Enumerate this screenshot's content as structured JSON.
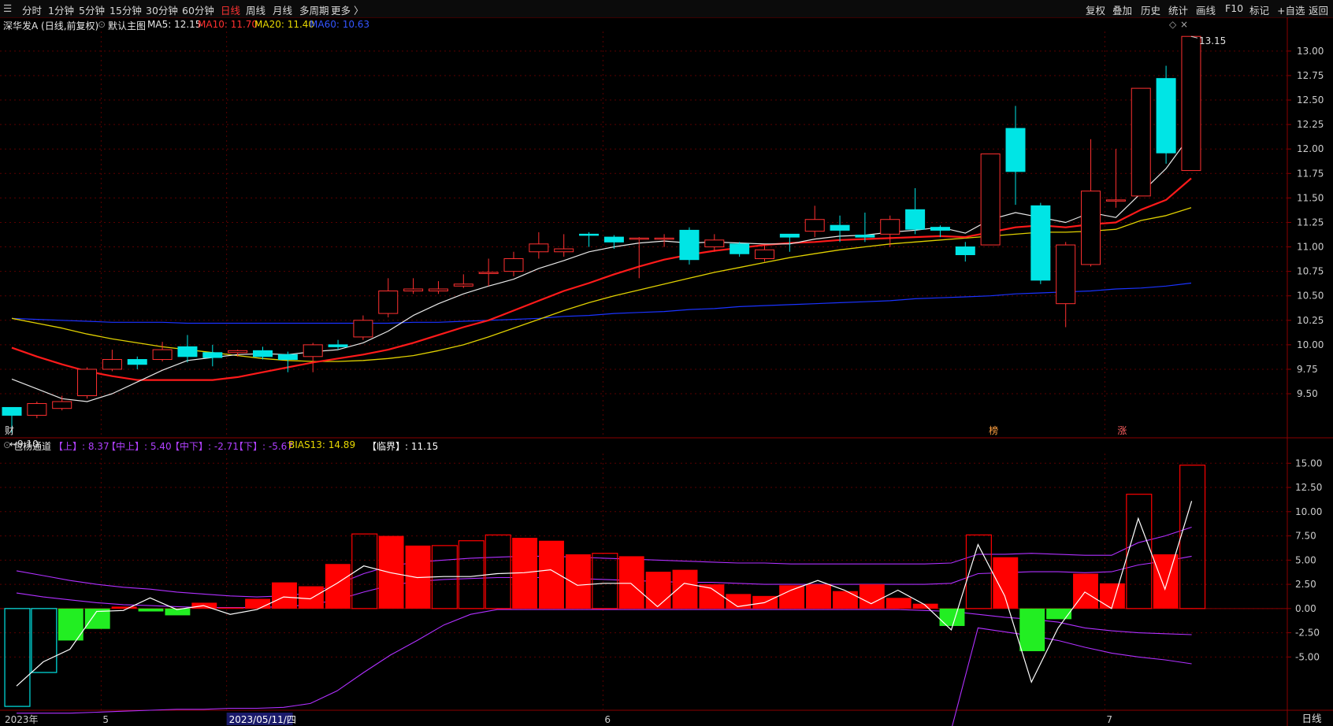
{
  "toolbar": {
    "periods": [
      {
        "label": "分时",
        "active": false
      },
      {
        "label": "1分钟",
        "active": false
      },
      {
        "label": "5分钟",
        "active": false
      },
      {
        "label": "15分钟",
        "active": false
      },
      {
        "label": "30分钟",
        "active": false
      },
      {
        "label": "60分钟",
        "active": false
      },
      {
        "label": "日线",
        "active": true
      },
      {
        "label": "周线",
        "active": false
      },
      {
        "label": "月线",
        "active": false
      },
      {
        "label": "多周期",
        "active": false
      },
      {
        "label": "更多 〉",
        "active": false
      }
    ],
    "right": [
      "复权",
      "叠加",
      "历史",
      "统计",
      "画线",
      "F10",
      "标记",
      "+自选",
      "返回"
    ]
  },
  "main_header": {
    "stock": "深华发A (日线,前复权)",
    "indicator": "默认主图",
    "ma5": "MA5: 12.15",
    "ma10": "MA10: 11.70",
    "ma20": "MA20: 11.40",
    "ma60": "MA60: 10.63"
  },
  "osc_header": {
    "name": "包杨通道",
    "up": "【上】: 8.37",
    "mid_up": "【中上】: 5.40",
    "mid_down": "【中下】: -2.71",
    "down": "【下】: -5.67",
    "bias": "BIAS13: 14.89",
    "critical": "【临界】: 11.15"
  },
  "annotations": {
    "high_label": "13.15",
    "low_label": "←9.10",
    "cai_marker": "财",
    "bang_marker": "榜",
    "zhang_marker": "涨"
  },
  "x_axis": {
    "labels": [
      {
        "text": "2023年",
        "idx": 0
      },
      {
        "text": "5",
        "idx": 4
      },
      {
        "text": "2023/05/11/四",
        "idx": 9
      },
      {
        "text": "6",
        "idx": 24
      },
      {
        "text": "7",
        "idx": 44
      }
    ]
  },
  "bottom_tab": "日线",
  "colors": {
    "up": "#ff3030",
    "down": "#00e5e5",
    "ma5": "#e8e8e8",
    "ma10": "#ff1a1a",
    "ma20": "#e0d000",
    "ma60": "#1a33ff",
    "channel": "#b030ff",
    "bias": "#ffffff",
    "osc_up": "#ff0000",
    "osc_down": "#22ee22",
    "grid": "#5a0000",
    "axis_text": "#cccccc"
  },
  "chart_data": [
    {
      "type": "candlestick",
      "title": "深华发A (日线,前复权)",
      "y_ticks": [
        9.5,
        9.75,
        10.0,
        10.25,
        10.5,
        10.75,
        11.0,
        11.25,
        11.5,
        11.75,
        12.0,
        12.25,
        12.5,
        12.75,
        13.0
      ],
      "ylim": [
        9.05,
        13.2
      ],
      "candles": [
        {
          "o": 9.36,
          "c": 9.28,
          "h": 9.36,
          "l": 9.1
        },
        {
          "o": 9.28,
          "c": 9.4,
          "h": 9.42,
          "l": 9.25
        },
        {
          "o": 9.35,
          "c": 9.42,
          "h": 9.48,
          "l": 9.33
        },
        {
          "o": 9.48,
          "c": 9.75,
          "h": 9.77,
          "l": 9.45
        },
        {
          "o": 9.75,
          "c": 9.85,
          "h": 9.95,
          "l": 9.73
        },
        {
          "o": 9.85,
          "c": 9.8,
          "h": 9.88,
          "l": 9.75
        },
        {
          "o": 9.85,
          "c": 9.95,
          "h": 10.03,
          "l": 9.83
        },
        {
          "o": 9.98,
          "c": 9.88,
          "h": 10.1,
          "l": 9.82
        },
        {
          "o": 9.92,
          "c": 9.87,
          "h": 10.0,
          "l": 9.78
        },
        {
          "o": 9.92,
          "c": 9.94,
          "h": 9.95,
          "l": 9.88
        },
        {
          "o": 9.94,
          "c": 9.88,
          "h": 9.98,
          "l": 9.85
        },
        {
          "o": 9.9,
          "c": 9.85,
          "h": 9.93,
          "l": 9.72
        },
        {
          "o": 9.88,
          "c": 10.0,
          "h": 10.02,
          "l": 9.72
        },
        {
          "o": 10.0,
          "c": 9.98,
          "h": 10.05,
          "l": 9.95
        },
        {
          "o": 10.08,
          "c": 10.25,
          "h": 10.3,
          "l": 10.05
        },
        {
          "o": 10.32,
          "c": 10.55,
          "h": 10.68,
          "l": 10.28
        },
        {
          "o": 10.55,
          "c": 10.57,
          "h": 10.68,
          "l": 10.52
        },
        {
          "o": 10.55,
          "c": 10.57,
          "h": 10.65,
          "l": 10.52
        },
        {
          "o": 10.6,
          "c": 10.62,
          "h": 10.72,
          "l": 10.58
        },
        {
          "o": 10.74,
          "c": 10.74,
          "h": 10.88,
          "l": 10.6
        },
        {
          "o": 10.75,
          "c": 10.88,
          "h": 10.95,
          "l": 10.7
        },
        {
          "o": 10.95,
          "c": 11.03,
          "h": 11.15,
          "l": 10.88
        },
        {
          "o": 10.95,
          "c": 10.98,
          "h": 11.13,
          "l": 10.9
        },
        {
          "o": 11.13,
          "c": 11.12,
          "h": 11.15,
          "l": 11.0
        },
        {
          "o": 11.1,
          "c": 11.05,
          "h": 11.12,
          "l": 10.98
        },
        {
          "o": 11.08,
          "c": 11.09,
          "h": 11.1,
          "l": 10.68
        },
        {
          "o": 11.08,
          "c": 11.09,
          "h": 11.13,
          "l": 11.0
        },
        {
          "o": 11.17,
          "c": 10.87,
          "h": 11.2,
          "l": 10.82
        },
        {
          "o": 11.0,
          "c": 11.07,
          "h": 11.13,
          "l": 10.95
        },
        {
          "o": 11.03,
          "c": 10.93,
          "h": 11.05,
          "l": 10.9
        },
        {
          "o": 10.88,
          "c": 10.97,
          "h": 11.02,
          "l": 10.85
        },
        {
          "o": 11.13,
          "c": 11.1,
          "h": 11.12,
          "l": 10.95
        },
        {
          "o": 11.16,
          "c": 11.28,
          "h": 11.42,
          "l": 11.1
        },
        {
          "o": 11.22,
          "c": 11.17,
          "h": 11.32,
          "l": 11.05
        },
        {
          "o": 11.12,
          "c": 11.1,
          "h": 11.35,
          "l": 11.05
        },
        {
          "o": 11.13,
          "c": 11.28,
          "h": 11.32,
          "l": 11.0
        },
        {
          "o": 11.38,
          "c": 11.18,
          "h": 11.6,
          "l": 11.13
        },
        {
          "o": 11.2,
          "c": 11.17,
          "h": 11.22,
          "l": 11.1
        },
        {
          "o": 11.0,
          "c": 10.92,
          "h": 11.05,
          "l": 10.85
        },
        {
          "o": 11.02,
          "c": 11.95,
          "h": 11.95,
          "l": 11.02
        },
        {
          "o": 12.21,
          "c": 11.77,
          "h": 12.44,
          "l": 11.43
        },
        {
          "o": 11.42,
          "c": 10.66,
          "h": 11.45,
          "l": 10.62
        },
        {
          "o": 10.42,
          "c": 11.02,
          "h": 11.05,
          "l": 10.18
        },
        {
          "o": 10.82,
          "c": 11.57,
          "h": 12.1,
          "l": 10.8
        },
        {
          "o": 11.47,
          "c": 11.48,
          "h": 12.0,
          "l": 11.4
        },
        {
          "o": 11.52,
          "c": 12.62,
          "h": 12.62,
          "l": 11.52
        },
        {
          "o": 12.72,
          "c": 11.96,
          "h": 12.85,
          "l": 11.85
        },
        {
          "o": 11.78,
          "c": 13.15,
          "h": 13.15,
          "l": 11.78
        }
      ],
      "ma5": [
        9.65,
        9.55,
        9.45,
        9.42,
        9.5,
        9.62,
        9.74,
        9.84,
        9.87,
        9.9,
        9.91,
        9.9,
        9.93,
        9.95,
        10.02,
        10.14,
        10.3,
        10.42,
        10.52,
        10.6,
        10.67,
        10.78,
        10.86,
        10.95,
        11.0,
        11.04,
        11.06,
        11.04,
        11.05,
        11.04,
        11.03,
        11.03,
        11.08,
        11.11,
        11.12,
        11.15,
        11.17,
        11.2,
        11.14,
        11.28,
        11.35,
        11.3,
        11.25,
        11.35,
        11.3,
        11.55,
        11.8,
        12.15
      ],
      "ma10": [
        9.97,
        9.88,
        9.8,
        9.73,
        9.68,
        9.64,
        9.64,
        9.64,
        9.64,
        9.67,
        9.72,
        9.77,
        9.82,
        9.86,
        9.9,
        9.95,
        10.02,
        10.1,
        10.18,
        10.25,
        10.35,
        10.45,
        10.55,
        10.63,
        10.72,
        10.8,
        10.87,
        10.92,
        10.96,
        10.99,
        11.02,
        11.04,
        11.05,
        11.07,
        11.08,
        11.09,
        11.1,
        11.11,
        11.1,
        11.15,
        11.2,
        11.22,
        11.2,
        11.23,
        11.25,
        11.38,
        11.48,
        11.7
      ],
      "ma20": [
        10.27,
        10.22,
        10.17,
        10.11,
        10.06,
        10.02,
        9.98,
        9.95,
        9.92,
        9.89,
        9.86,
        9.84,
        9.83,
        9.83,
        9.84,
        9.86,
        9.89,
        9.94,
        10.0,
        10.08,
        10.17,
        10.26,
        10.35,
        10.43,
        10.5,
        10.56,
        10.62,
        10.68,
        10.74,
        10.79,
        10.84,
        10.89,
        10.93,
        10.97,
        11.0,
        11.03,
        11.05,
        11.07,
        11.09,
        11.11,
        11.13,
        11.15,
        11.15,
        11.16,
        11.18,
        11.27,
        11.32,
        11.4
      ],
      "ma60": [
        10.27,
        10.26,
        10.25,
        10.24,
        10.23,
        10.23,
        10.23,
        10.22,
        10.22,
        10.22,
        10.22,
        10.22,
        10.22,
        10.22,
        10.22,
        10.22,
        10.23,
        10.23,
        10.24,
        10.25,
        10.26,
        10.27,
        10.29,
        10.3,
        10.32,
        10.33,
        10.34,
        10.36,
        10.37,
        10.39,
        10.4,
        10.41,
        10.42,
        10.43,
        10.44,
        10.45,
        10.47,
        10.48,
        10.49,
        10.5,
        10.52,
        10.53,
        10.54,
        10.55,
        10.57,
        10.58,
        10.6,
        10.63
      ]
    },
    {
      "type": "bar",
      "title": "包杨通道",
      "y_ticks": [
        -5.0,
        -2.5,
        0.0,
        2.5,
        5.0,
        7.5,
        10.0,
        12.5,
        15.0
      ],
      "ylim": [
        -10.5,
        16.0
      ],
      "osc": [
        -10.1,
        -6.6,
        -3.3,
        -2.1,
        0.2,
        -0.3,
        -0.7,
        0.6,
        0.1,
        1.0,
        2.7,
        2.3,
        4.6,
        7.7,
        7.5,
        6.5,
        6.5,
        7.0,
        7.6,
        7.3,
        7.0,
        5.6,
        5.7,
        5.4,
        3.8,
        4.0,
        2.5,
        1.5,
        1.3,
        2.4,
        2.5,
        1.8,
        2.5,
        1.1,
        0.5,
        -1.8,
        7.6,
        5.3,
        -4.4,
        -1.1,
        3.6,
        2.6,
        11.8,
        5.6,
        14.8
      ],
      "bias13": [
        -8.0,
        -5.5,
        -4.2,
        -0.3,
        -0.2,
        1.1,
        -0.1,
        0.3,
        -0.6,
        -0.1,
        1.2,
        1.0,
        2.6,
        4.4,
        3.7,
        3.2,
        3.3,
        3.3,
        3.6,
        3.7,
        4.0,
        2.4,
        2.6,
        2.6,
        0.2,
        2.6,
        2.1,
        0.2,
        0.6,
        1.9,
        2.9,
        1.9,
        0.5,
        1.9,
        0.4,
        -2.2,
        6.6,
        1.3,
        -7.6,
        -2.0,
        1.7,
        0.0,
        9.3,
        2.0,
        11.1
      ],
      "up": [
        3.9,
        3.4,
        2.9,
        2.5,
        2.2,
        2.0,
        1.7,
        1.5,
        1.3,
        1.2,
        1.3,
        1.6,
        2.5,
        3.6,
        4.4,
        4.8,
        5.0,
        5.2,
        5.3,
        5.4,
        5.4,
        5.3,
        5.2,
        5.1,
        5.0,
        4.9,
        4.8,
        4.7,
        4.7,
        4.6,
        4.6,
        4.6,
        4.6,
        4.6,
        4.6,
        4.7,
        5.6,
        5.6,
        5.7,
        5.6,
        5.5,
        5.5,
        6.8,
        7.5,
        8.4
      ],
      "mid_up": [
        1.6,
        1.2,
        0.9,
        0.6,
        0.4,
        0.3,
        0.2,
        0.1,
        0.1,
        0.1,
        0.2,
        0.4,
        0.9,
        1.7,
        2.4,
        2.8,
        3.0,
        3.1,
        3.2,
        3.2,
        3.2,
        3.1,
        3.0,
        2.9,
        2.8,
        2.7,
        2.7,
        2.6,
        2.5,
        2.5,
        2.5,
        2.5,
        2.5,
        2.5,
        2.5,
        2.6,
        3.6,
        3.7,
        3.8,
        3.8,
        3.7,
        3.8,
        4.5,
        4.9,
        5.4
      ],
      "mid_down": [
        -10.8,
        -10.8,
        -10.8,
        -10.7,
        -10.6,
        -10.5,
        -10.4,
        -10.4,
        -10.3,
        -10.3,
        -10.2,
        -9.8,
        -8.5,
        -6.6,
        -4.8,
        -3.3,
        -1.7,
        -0.6,
        -0.1,
        -0.1,
        -0.1,
        -0.1,
        -0.1,
        -0.1,
        -0.1,
        -0.1,
        -0.1,
        -0.1,
        -0.1,
        -0.1,
        -0.1,
        -0.1,
        -0.1,
        -0.1,
        -0.2,
        -0.3,
        -0.6,
        -0.9,
        -1.1,
        -1.4,
        -2.0,
        -2.3,
        -2.5,
        -2.6,
        -2.7
      ],
      "down": [
        -12.5,
        -12.5,
        -12.5,
        -12.5,
        -12.5,
        -12.5,
        -12.5,
        -12.5,
        -12.5,
        -12.5,
        -12.5,
        -12.5,
        -12.5,
        -12.5,
        -12.5,
        -12.5,
        -12.5,
        -12.5,
        -12.5,
        -12.5,
        -12.5,
        -12.5,
        -12.5,
        -12.5,
        -12.5,
        -12.5,
        -12.5,
        -12.5,
        -12.5,
        -12.5,
        -12.5,
        -12.5,
        -12.5,
        -12.5,
        -12.5,
        -12.5,
        -2.0,
        -2.4,
        -2.8,
        -3.3,
        -4.0,
        -4.6,
        -5.0,
        -5.3,
        -5.7
      ]
    }
  ]
}
